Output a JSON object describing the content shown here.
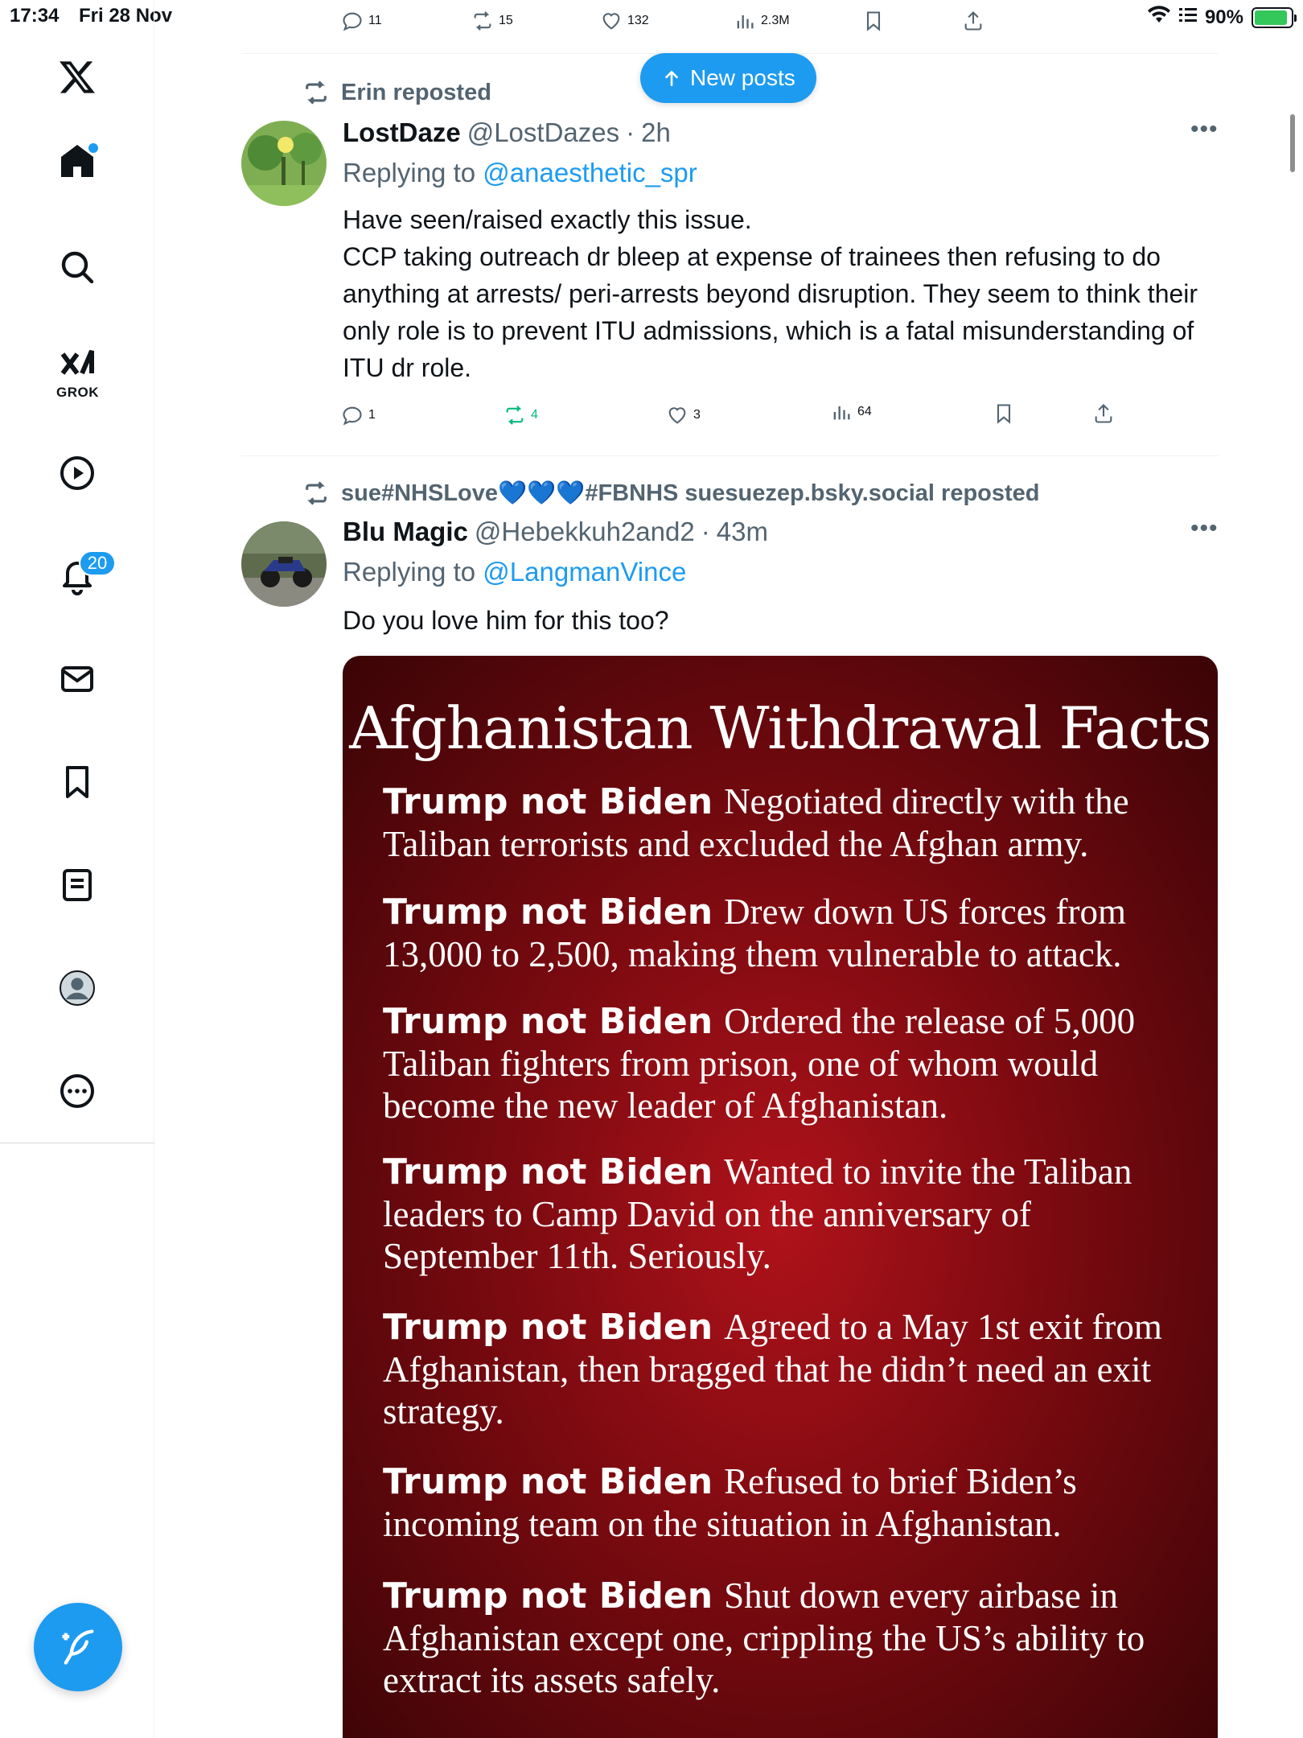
{
  "status_bar": {
    "time": "17:34",
    "date": "Fri 28 Nov",
    "battery_label": "90%",
    "battery_level": 0.9,
    "battery_color": "#34c759"
  },
  "sidebar": {
    "grok_label": "GROK",
    "notifications_count": "20",
    "items": [
      "x-logo-icon",
      "home-icon",
      "search-icon",
      "grok-icon",
      "video-icon",
      "bell-icon",
      "mail-icon",
      "bookmark-icon",
      "lists-icon",
      "profile-icon",
      "more-icon"
    ]
  },
  "top_actions": {
    "replies": "11",
    "reposts": "15",
    "likes": "132",
    "views": "2.3M"
  },
  "new_posts": "New posts",
  "tweets": [
    {
      "repost_label": "Erin reposted",
      "name": "LostDaze",
      "handle": "@LostDazes",
      "sep": "·",
      "time": "2h",
      "replying_prefix": "Replying to",
      "replying_to": "@anaesthetic_spr",
      "text": "Have seen/raised exactly this issue.\nCCP taking outreach dr bleep at expense of trainees then refusing to do anything at arrests/ peri-arrests beyond disruption. They seem to think their only role is to prevent ITU admissions, which is a fatal misunderstanding of ITU dr role.",
      "replies": "1",
      "reposts": "4",
      "likes": "3",
      "views": "64"
    },
    {
      "repost_label": "sue#NHSLove💙💙💙#FBNHS suesuezep.bsky.social reposted",
      "name": "Blu Magic",
      "handle": "@Hebekkuh2and2",
      "sep": "·",
      "time": "43m",
      "replying_prefix": "Replying to",
      "replying_to": "@LangmanVince",
      "text": "Do you love him for this too?"
    }
  ],
  "meme": {
    "title": "Afghanistan Withdrawal Facts",
    "lead": "Trump not Biden",
    "facts": [
      "Negotiated directly with the Taliban terrorists and excluded the Afghan army.",
      "Drew down US forces from 13,000 to 2,500, making them vulnerable to attack.",
      "Ordered the release of 5,000 Taliban fighters from prison, one of whom would become the new leader of Afghanistan.",
      "Wanted to invite the Taliban leaders to Camp David on the anniversary of September 11th. Seriously.",
      "Agreed to a May 1st exit from Afghanistan, then bragged that he didn’t need an exit strategy.",
      "Refused to brief Biden’s incoming team on the situation in Afghanistan.",
      "Shut down every airbase in Afghanistan except one, crippling the US’s ability to extract its assets safely."
    ]
  },
  "colors": {
    "accent": "#1d9bf0",
    "repost_green": "#00ba7c",
    "muted": "#536471"
  }
}
